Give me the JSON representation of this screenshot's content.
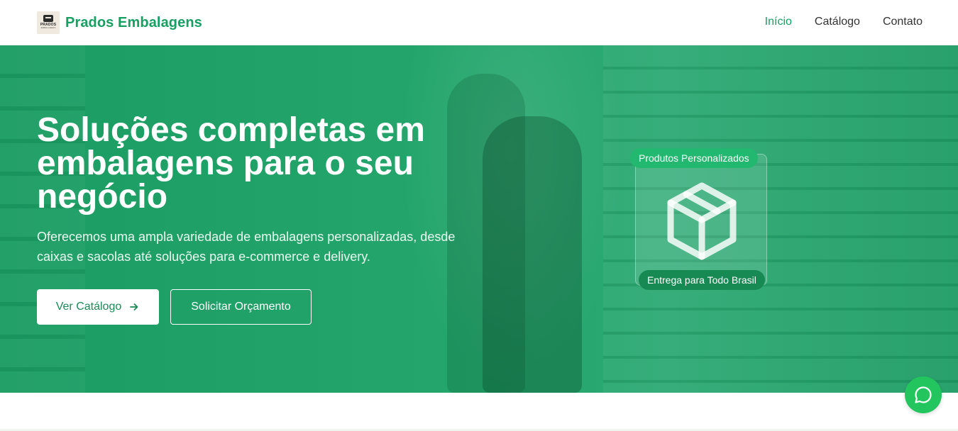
{
  "header": {
    "brand": "Prados Embalagens",
    "logo_text": "PRADOS",
    "logo_subtext": "EMBALAGENS",
    "nav": [
      {
        "label": "Início",
        "active": true
      },
      {
        "label": "Catálogo",
        "active": false
      },
      {
        "label": "Contato",
        "active": false
      }
    ]
  },
  "hero": {
    "title": "Soluções completas em embalagens para o seu negócio",
    "subtitle": "Oferecemos uma ampla variedade de embalagens personalizadas, desde caixas e sacolas até soluções para e-commerce e delivery.",
    "primary_button": "Ver Catálogo",
    "primary_button_icon": "arrow-right-icon",
    "secondary_button": "Solicitar Orçamento",
    "card": {
      "icon": "package-icon",
      "badge_top": "Produtos Personalizados",
      "badge_bottom": "Entrega para Todo Brasil"
    }
  },
  "floating": {
    "whatsapp_icon": "whatsapp-icon"
  },
  "colors": {
    "brand_green": "#16a062",
    "hero_green": "#1f9e66",
    "whatsapp_green": "#22c55e"
  }
}
